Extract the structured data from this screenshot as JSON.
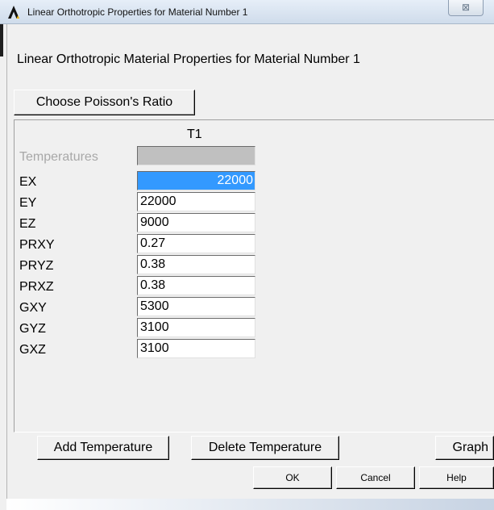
{
  "window": {
    "title": "Linear Orthotropic Properties for Material Number 1",
    "close_icon": "close-x-icon",
    "close_glyph": "⊠",
    "logo_icon": "ansys-logo-icon"
  },
  "dialog": {
    "heading": "Linear Orthotropic Material Properties for Material Number 1",
    "choose_poissons_label": "Choose Poisson's Ratio"
  },
  "table": {
    "column_header": "T1",
    "rows": [
      {
        "label": "Temperatures",
        "value": ""
      },
      {
        "label": "EX",
        "value": "22000"
      },
      {
        "label": "EY",
        "value": "22000"
      },
      {
        "label": "EZ",
        "value": "9000"
      },
      {
        "label": "PRXY",
        "value": "0.27"
      },
      {
        "label": "PRYZ",
        "value": "0.38"
      },
      {
        "label": "PRXZ",
        "value": "0.38"
      },
      {
        "label": "GXY",
        "value": "5300"
      },
      {
        "label": "GYZ",
        "value": "3100"
      },
      {
        "label": "GXZ",
        "value": "3100"
      }
    ]
  },
  "buttons": {
    "add_temperature": "Add Temperature",
    "delete_temperature": "Delete Temperature",
    "graph": "Graph",
    "ok": "OK",
    "cancel": "Cancel",
    "help": "Help"
  },
  "colors": {
    "selection": "#3399ff",
    "disabled_cell": "#c0c0c0",
    "dialog_bg": "#f0f0f0"
  }
}
